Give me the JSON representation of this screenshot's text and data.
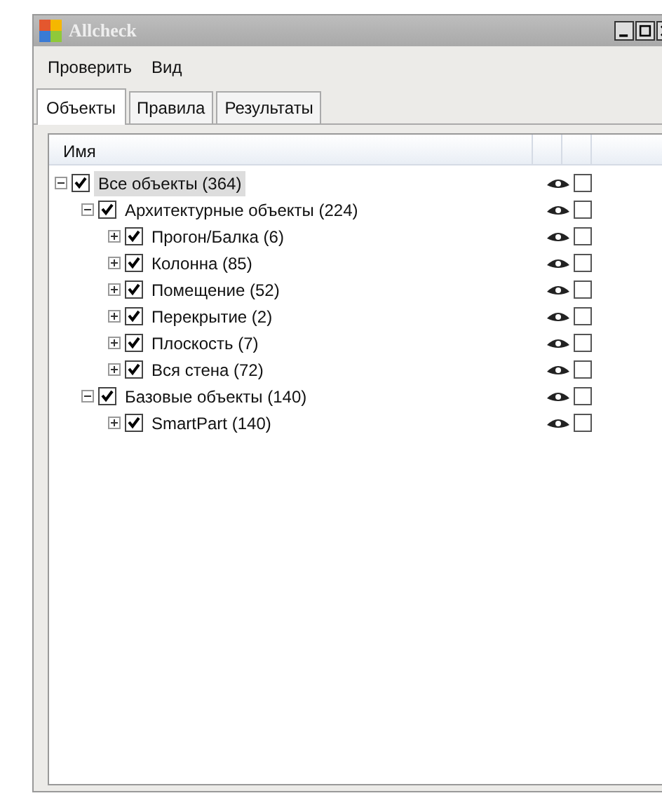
{
  "window": {
    "title": "Allcheck"
  },
  "menu": [
    "Проверить",
    "Вид"
  ],
  "tabs": [
    {
      "label": "Объекты",
      "selected": true
    },
    {
      "label": "Правила",
      "selected": false
    },
    {
      "label": "Результаты",
      "selected": false
    }
  ],
  "tree": {
    "column": "Имя",
    "nodes": [
      {
        "label": "Все объекты (364)",
        "checked": true,
        "flag": false,
        "selected": true,
        "expanded": true,
        "children": [
          {
            "label": "Архитектурные объекты (224)",
            "checked": true,
            "flag": false,
            "selected": false,
            "expanded": true,
            "children": [
              {
                "label": "Прогон/Балка (6)",
                "checked": true,
                "flag": false,
                "selected": false,
                "expanded": false
              },
              {
                "label": "Колонна (85)",
                "checked": true,
                "flag": false,
                "selected": false,
                "expanded": false
              },
              {
                "label": "Помещение (52)",
                "checked": true,
                "flag": false,
                "selected": false,
                "expanded": false
              },
              {
                "label": "Перекрытие (2)",
                "checked": true,
                "flag": false,
                "selected": false,
                "expanded": false
              },
              {
                "label": "Плоскость (7)",
                "checked": true,
                "flag": false,
                "selected": false,
                "expanded": false
              },
              {
                "label": "Вся стена (72)",
                "checked": true,
                "flag": false,
                "selected": false,
                "expanded": false
              }
            ]
          },
          {
            "label": "Базовые объекты (140)",
            "checked": true,
            "flag": false,
            "selected": false,
            "expanded": true,
            "children": [
              {
                "label": "SmartPart (140)",
                "checked": true,
                "flag": false,
                "selected": false,
                "expanded": false
              }
            ]
          }
        ]
      }
    ]
  }
}
